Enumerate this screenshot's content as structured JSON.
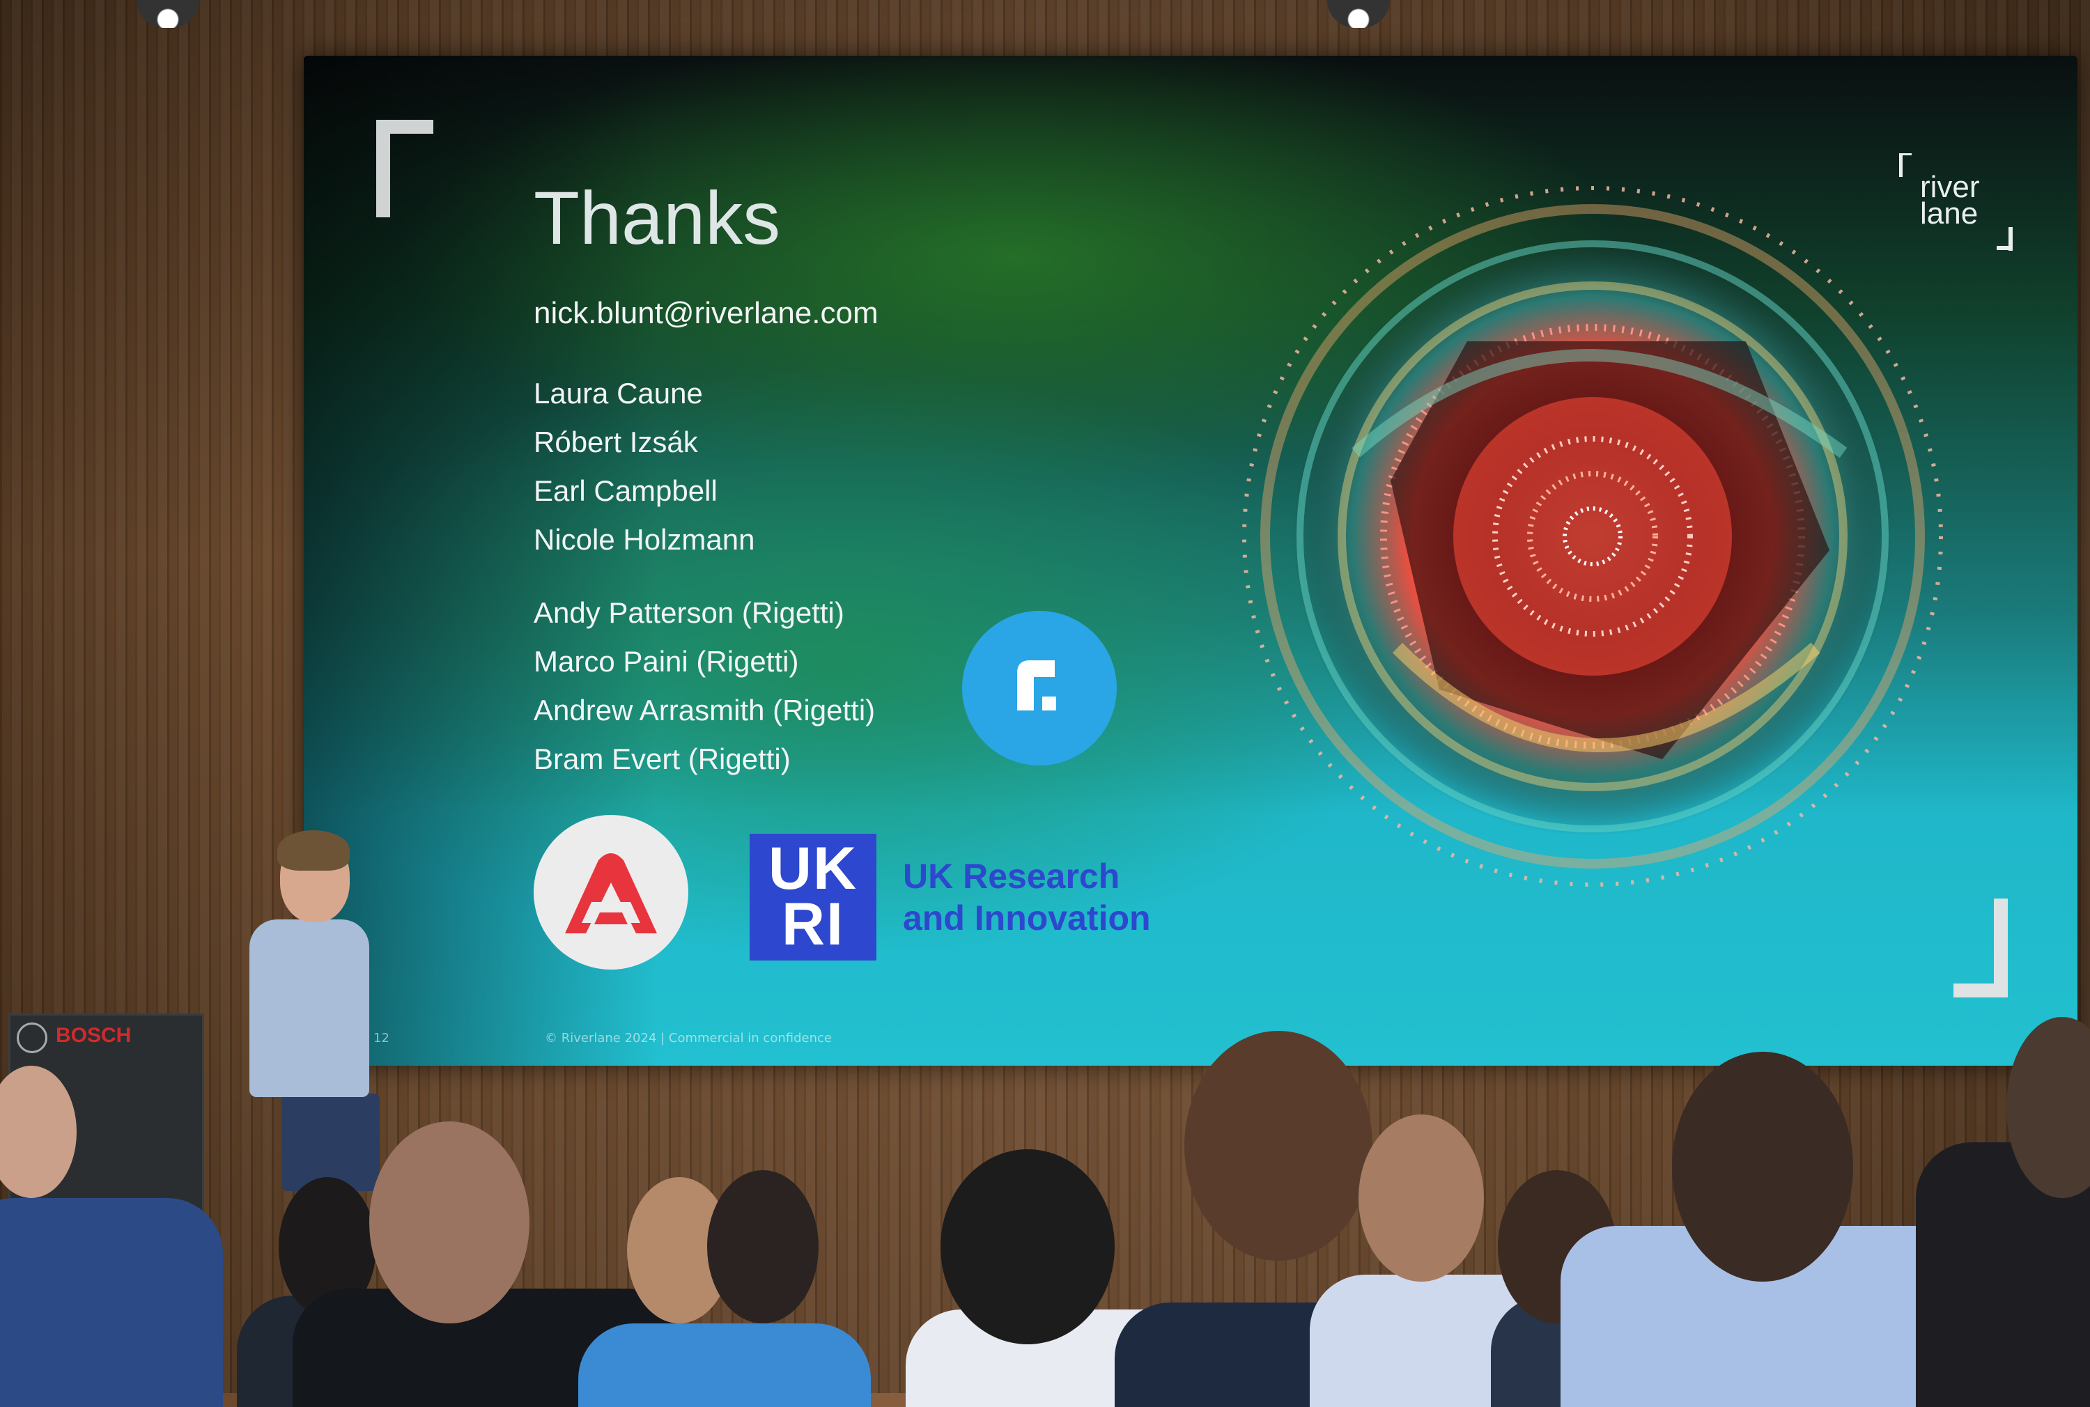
{
  "venue": {
    "sponsor_logo_text": "BOSCH"
  },
  "slide": {
    "title": "Thanks",
    "email": "nick.blunt@riverlane.com",
    "team": [
      "Laura Caune",
      "Róbert Izsák",
      "Earl Campbell",
      "Nicole Holzmann"
    ],
    "collaborators": [
      "Andy Patterson (Rigetti)",
      "Marco Paini (Rigetti)",
      "Andrew Arrasmith (Rigetti)",
      "Bram Evert (Rigetti)"
    ],
    "brand_logo_line1": "river",
    "brand_logo_line2": "lane",
    "ukri_mark_line1": "UK",
    "ukri_mark_line2": "RI",
    "ukri_text_line1": "UK Research",
    "ukri_text_line2": "and Innovation",
    "slide_number": "12",
    "footer": "© Riverlane 2024 | Commercial in confidence"
  },
  "colors": {
    "ukri_blue": "#2d48ce",
    "riverlane_blue": "#2aa5e6",
    "rigetti_red": "#e8343c",
    "bosch_red": "#d12a2a"
  }
}
